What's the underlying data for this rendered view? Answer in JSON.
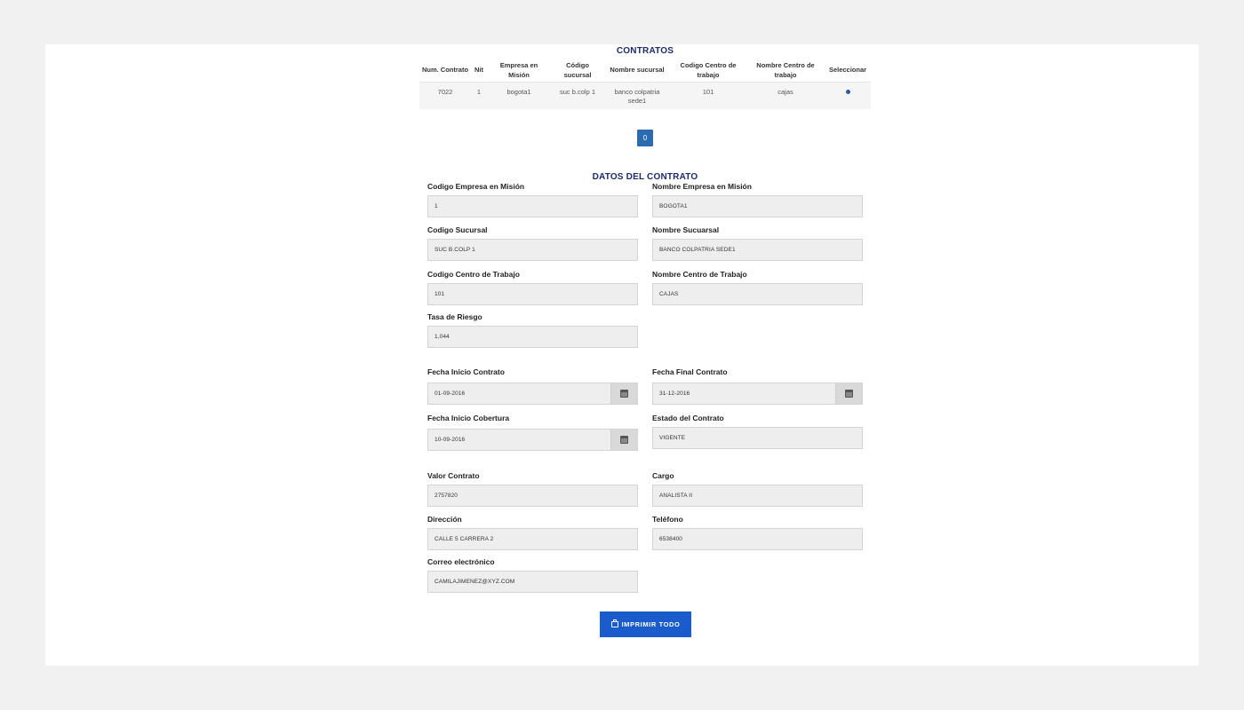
{
  "contratos": {
    "title": "CONTRATOS",
    "columns": [
      "Num. Contrato",
      "Nit",
      "Empresa en Misión",
      "Código sucursal",
      "Nombre sucursal",
      "Codigo Centro de trabajo",
      "Nombre Centro de trabajo",
      "Seleccionar"
    ],
    "rows": [
      [
        "7022",
        "1",
        "bogota1",
        "suc b.colp 1",
        "banco colpatria sede1",
        "101",
        "cajas",
        ""
      ]
    ]
  },
  "pagination": {
    "current": "0"
  },
  "datos": {
    "title": "DATOS DEL CONTRATO",
    "codigo_empresa": {
      "label": "Codigo Empresa en Misión",
      "value": "1"
    },
    "nombre_empresa": {
      "label": "Nombre Empresa en Misión",
      "value": "BOGOTA1"
    },
    "codigo_sucursal": {
      "label": "Codigo Sucursal",
      "value": "SUC B.COLP 1"
    },
    "nombre_sucursal": {
      "label": "Nombre Sucuarsal",
      "value": "BANCO COLPATRIA SEDE1"
    },
    "codigo_centro": {
      "label": "Codigo Centro de Trabajo",
      "value": "101"
    },
    "nombre_centro": {
      "label": "Nombre Centro de Trabajo",
      "value": "CAJAS"
    },
    "tasa_riesgo": {
      "label": "Tasa de Riesgo",
      "value": "1,044"
    },
    "fecha_inicio_contrato": {
      "label": "Fecha Inicio Contrato",
      "value": "01-09-2016"
    },
    "fecha_final_contrato": {
      "label": "Fecha Final Contrato",
      "value": "31-12-2016"
    },
    "fecha_inicio_cobertura": {
      "label": "Fecha Inicio Cobertura",
      "value": "10-09-2016"
    },
    "estado_contrato": {
      "label": "Estado del Contrato",
      "value": "VIGENTE"
    },
    "valor_contrato": {
      "label": "Valor Contrato",
      "value": "2757820"
    },
    "cargo": {
      "label": "Cargo",
      "value": "ANALISTA II"
    },
    "direccion": {
      "label": "Dirección",
      "value": "CALLE 5 CARRERA 2"
    },
    "telefono": {
      "label": "Teléfono",
      "value": "6538400"
    },
    "correo": {
      "label": "Correo electrónico",
      "value": "CAMILAJIMENEZ@XYZ.COM"
    }
  },
  "actions": {
    "print_label": "IMPRIMIR TODO"
  },
  "icons": {
    "calendar": "calendar-icon",
    "printer": "printer-icon"
  },
  "colors": {
    "title": "#1b2a6b",
    "primary_button": "#1a5ccc",
    "page_button": "#2d6bb0"
  }
}
